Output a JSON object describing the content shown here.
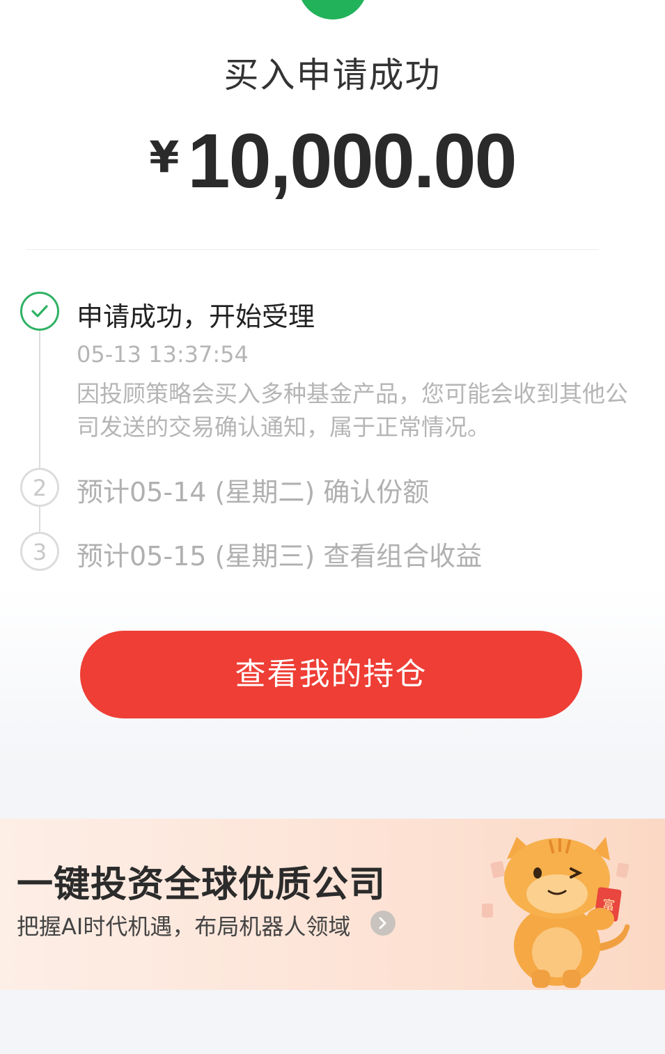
{
  "header": {
    "title": "买入申请成功",
    "currency_symbol": "¥",
    "amount": "10,000.00"
  },
  "timeline": {
    "step1": {
      "title": "申请成功，开始受理",
      "time": "05-13 13:37:54",
      "description": "因投顾策略会买入多种基金产品，您可能会收到其他公司发送的交易确认通知，属于正常情况。"
    },
    "step2": {
      "number": "2",
      "label": "预计05-14 (星期二) 确认份额"
    },
    "step3": {
      "number": "3",
      "label": "预计05-15 (星期三) 查看组合收益"
    }
  },
  "actions": {
    "view_holdings_label": "查看我的持仓"
  },
  "banner": {
    "title": "一键投资全球优质公司",
    "subtitle": "把握AI时代机遇，布局机器人领域",
    "arrow_icon": "chevron-right-icon",
    "mascot": "cat-mascot",
    "mascot_card_text": "富"
  },
  "colors": {
    "success_green": "#2fb264",
    "primary_red": "#ee3e35",
    "muted_text": "#b5b5b5"
  }
}
